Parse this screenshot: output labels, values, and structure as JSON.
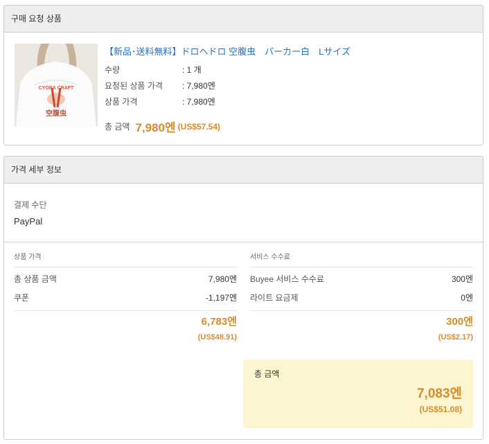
{
  "product_panel": {
    "title": "구매 요청 상품",
    "product": {
      "name": "【新品･送料無料】ドロヘドロ 空腹虫　パーカー白　Lサイズ",
      "rows": [
        {
          "label": "수량",
          "value": ": 1 개"
        },
        {
          "label": "요청된 상품 가격",
          "value": ": 7,980엔"
        },
        {
          "label": "상품 가격",
          "value": ": 7,980엔"
        }
      ],
      "total_label": "총 금액",
      "total_yen": "7,980엔",
      "total_usd": "(US$57.54)",
      "image_text": {
        "top": "CYOBA CRAFT",
        "bottom": "空腹虫"
      }
    }
  },
  "price_panel": {
    "title": "가격 세부 정보",
    "payment_label": "결제 수단",
    "payment_value": "PayPal",
    "product_col": {
      "title": "상품 가격",
      "rows": [
        {
          "label": "총 상품 금액",
          "value": "7,980엔"
        },
        {
          "label": "쿠폰",
          "value": "-1,197엔"
        }
      ],
      "subtotal": "6,783엔",
      "subtotal_usd": "(US$48.91)"
    },
    "service_col": {
      "title": "서비스 수수료",
      "rows": [
        {
          "label": "Buyee 서비스 수수료",
          "value": "300엔"
        },
        {
          "label": "라이트 요금제",
          "value": "0엔"
        }
      ],
      "subtotal": "300엔",
      "subtotal_usd": "(US$2.17)"
    },
    "grand_total": {
      "label": "총 금액",
      "yen": "7,083엔",
      "usd": "(US$51.08)"
    }
  },
  "colors": {
    "accent_orange": "#d98a2b",
    "link_blue": "#2a6ebb",
    "header_bg": "#eeeeee",
    "grand_bg": "#fdf5cf"
  }
}
